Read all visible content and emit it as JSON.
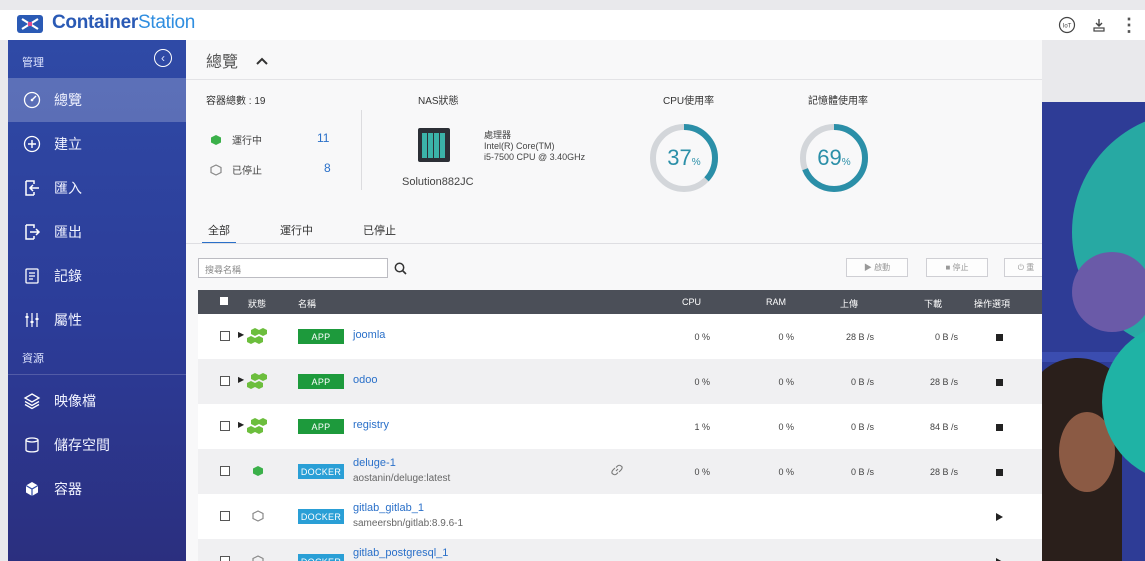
{
  "app": {
    "name_bold": "Container",
    "name_rest": "Station",
    "top_icons": [
      "iot-icon",
      "download-icon",
      "more-vertical-icon"
    ],
    "top_icon_glyphs": {
      "iot": "IoT",
      "download": "⇩",
      "more": "⋮"
    }
  },
  "sidebar": {
    "section_manage": "管理",
    "collapse_glyph": "‹",
    "items": [
      {
        "label": "總覽",
        "icon": "dashboard-icon",
        "active": true
      },
      {
        "label": "建立",
        "icon": "plus-circle-icon"
      },
      {
        "label": "匯入",
        "icon": "import-icon"
      },
      {
        "label": "匯出",
        "icon": "export-icon"
      },
      {
        "label": "記錄",
        "icon": "log-icon"
      },
      {
        "label": "屬性",
        "icon": "sliders-icon"
      }
    ],
    "section_resources": "資源",
    "resource_items": [
      {
        "label": "映像檔",
        "icon": "layers-icon"
      },
      {
        "label": "儲存空間",
        "icon": "database-icon"
      },
      {
        "label": "容器",
        "icon": "cube-icon"
      }
    ]
  },
  "main": {
    "title": "總覽",
    "caret": "^",
    "summary": {
      "total_label": "容器總數 : 19",
      "running_label": "運行中",
      "running_count": "11",
      "stopped_label": "已停止",
      "stopped_count": "8",
      "nas_label": "NAS狀態",
      "nas_name": "Solution882JC",
      "processor_label": "處理器",
      "processor_line1": "Intel(R) Core(TM)",
      "processor_line2": "i5-7500 CPU @ 3.40GHz",
      "cpu_label": "CPU使用率",
      "cpu_value": "37",
      "cpu_percent": 37,
      "mem_label": "記憶體使用率",
      "mem_value": "69",
      "mem_percent": 69,
      "percent_sign": "%"
    },
    "tabs": [
      "全部",
      "運行中",
      "已停止"
    ],
    "search_placeholder": "搜尋名稱",
    "toolbar": {
      "start": "▶ 啟動",
      "stop": "■ 停止",
      "restart": "⏻ 重"
    },
    "columns": {
      "status": "狀態",
      "name": "名稱",
      "cpu": "CPU",
      "ram": "RAM",
      "upload": "上傳",
      "download": "下載",
      "actions": "操作選項"
    },
    "rows": [
      {
        "type": "APP",
        "name": "joomla",
        "sub": "",
        "cpu": "0 %",
        "ram": "0 %",
        "up": "28 B /s",
        "down": "0 B /s",
        "action": "stop"
      },
      {
        "type": "APP",
        "name": "odoo",
        "sub": "",
        "cpu": "0 %",
        "ram": "0 %",
        "up": "0 B /s",
        "down": "28 B /s",
        "action": "stop"
      },
      {
        "type": "APP",
        "name": "registry",
        "sub": "",
        "cpu": "1 %",
        "ram": "0 %",
        "up": "0 B /s",
        "down": "84 B /s",
        "action": "stop"
      },
      {
        "type": "DOCKER",
        "name": "deluge-1",
        "sub": "aostanin/deluge:latest",
        "cpu": "0 %",
        "ram": "0 %",
        "up": "0 B /s",
        "down": "28 B /s",
        "action": "stop"
      },
      {
        "type": "DOCKER",
        "name": "gitlab_gitlab_1",
        "sub": "sameersbn/gitlab:8.9.6-1",
        "cpu": "",
        "ram": "",
        "up": "",
        "down": "",
        "action": "play"
      },
      {
        "type": "DOCKER",
        "name": "gitlab_postgresql_1",
        "sub": "",
        "cpu": "",
        "ram": "",
        "up": "",
        "down": "",
        "action": "play"
      }
    ]
  },
  "colors": {
    "accent": "#2a70c9",
    "app_badge": "#1d9a3c",
    "docker_badge": "#2a9fd6",
    "gauge": "#2b8fa8",
    "sidebar": "#2f4aa6"
  }
}
